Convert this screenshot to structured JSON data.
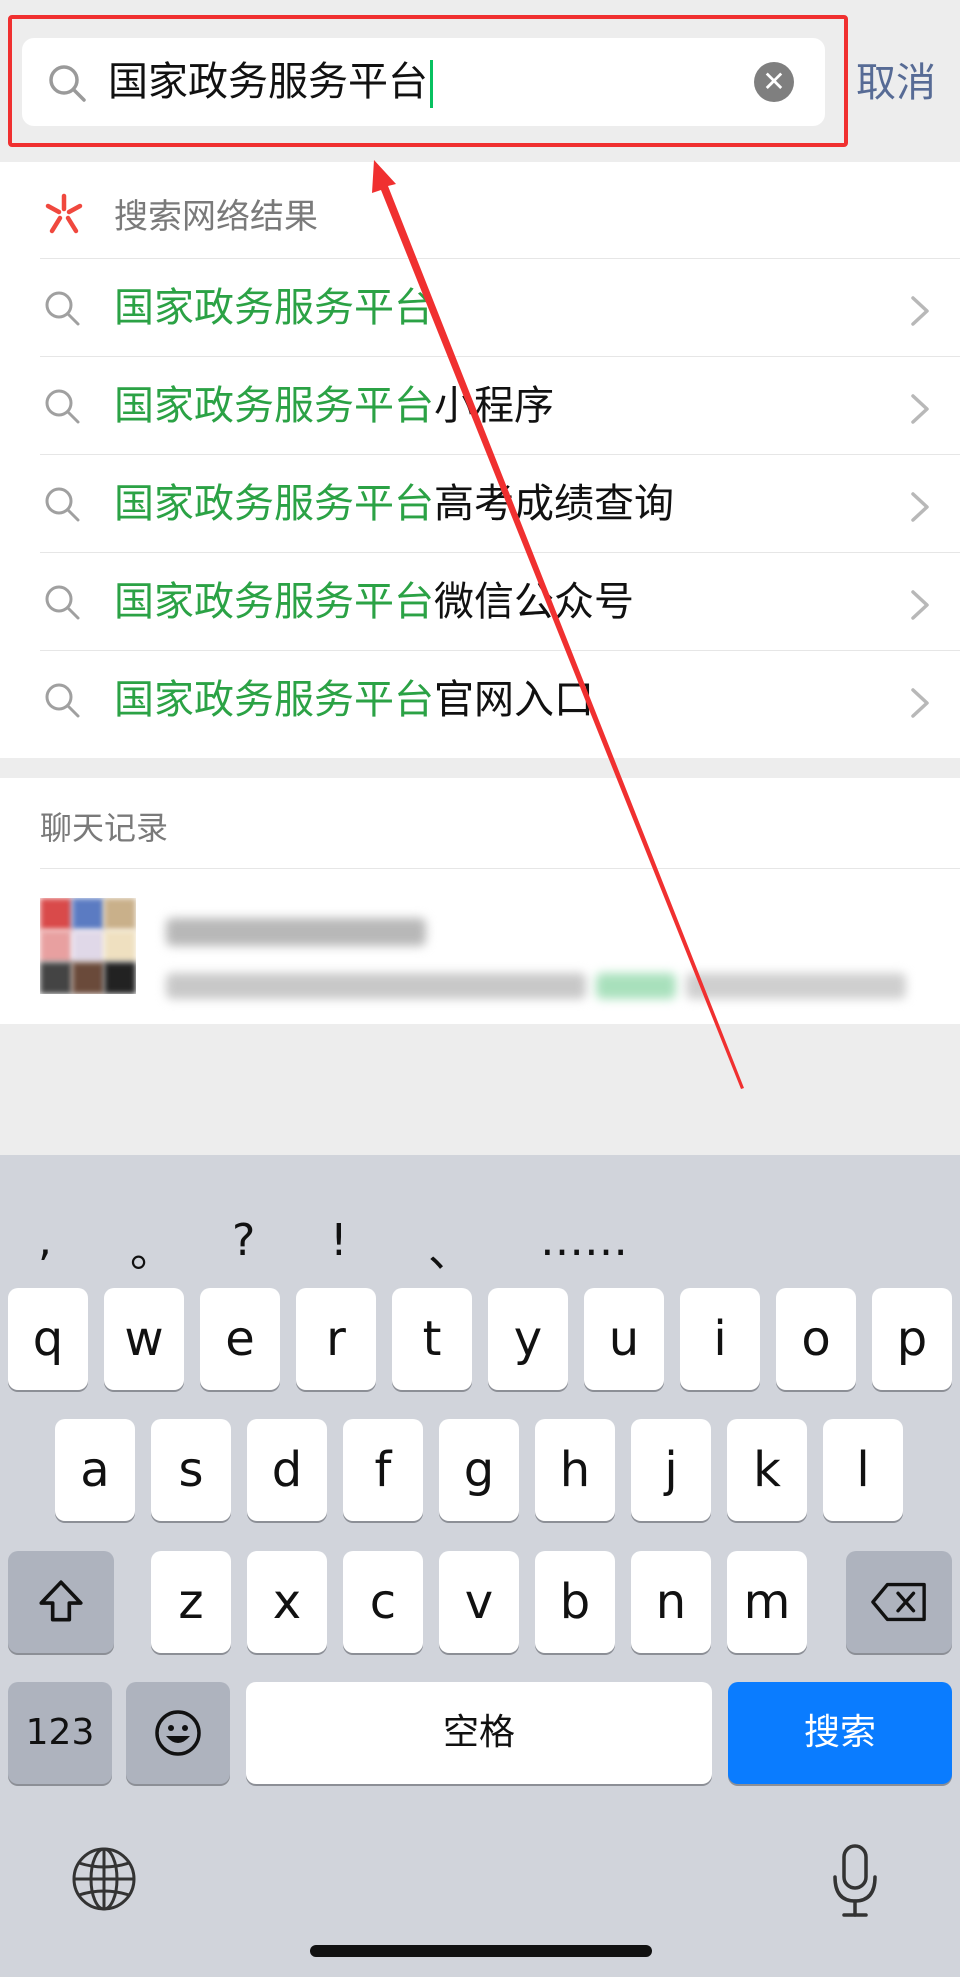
{
  "search": {
    "query": "国家政务服务平台",
    "clear_glyph": "✕",
    "cancel_label": "取消"
  },
  "web_results": {
    "header": "搜索网络结果",
    "items": [
      {
        "highlight": "国家政务服务平台",
        "rest": ""
      },
      {
        "highlight": "国家政务服务平台",
        "rest": "小程序"
      },
      {
        "highlight": "国家政务服务平台",
        "rest": "高考成绩查询"
      },
      {
        "highlight": "国家政务服务平台",
        "rest": "微信公众号"
      },
      {
        "highlight": "国家政务服务平台",
        "rest": "官网入口"
      }
    ]
  },
  "chat_history": {
    "header": "聊天记录"
  },
  "keyboard": {
    "punctuation": [
      ",",
      "。",
      "?",
      "!",
      "、",
      "……"
    ],
    "row1": [
      "q",
      "w",
      "e",
      "r",
      "t",
      "y",
      "u",
      "i",
      "o",
      "p"
    ],
    "row2": [
      "a",
      "s",
      "d",
      "f",
      "g",
      "h",
      "j",
      "k",
      "l"
    ],
    "row3": [
      "z",
      "x",
      "c",
      "v",
      "b",
      "n",
      "m"
    ],
    "numbers_label": "123",
    "space_label": "空格",
    "search_label": "搜索"
  },
  "colors": {
    "highlight_green": "#2ba245",
    "link_blue": "#576b95",
    "annotation_red": "#f03030",
    "search_key_blue": "#0a7cff"
  },
  "icons": [
    "search-icon",
    "clear-icon",
    "web-search-icon",
    "chevron-right-icon",
    "shift-icon",
    "backspace-icon",
    "emoji-icon",
    "globe-icon",
    "microphone-icon"
  ]
}
